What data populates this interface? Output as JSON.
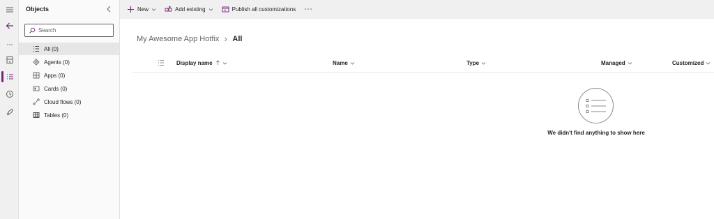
{
  "panel": {
    "title": "Objects",
    "search_placeholder": "Search",
    "items": [
      {
        "label": "All (0)",
        "icon": "list-icon",
        "selected": true
      },
      {
        "label": "Agents (0)",
        "icon": "agent-icon"
      },
      {
        "label": "Apps (0)",
        "icon": "apps-icon"
      },
      {
        "label": "Cards (0)",
        "icon": "card-icon"
      },
      {
        "label": "Cloud flows (0)",
        "icon": "flow-icon"
      },
      {
        "label": "Tables (0)",
        "icon": "table-icon"
      }
    ]
  },
  "toolbar": {
    "new_label": "New",
    "add_existing_label": "Add existing",
    "publish_label": "Publish all customizations"
  },
  "breadcrumb": {
    "parent": "My Awesome App Hotfix",
    "current": "All"
  },
  "columns": {
    "display_name": "Display name",
    "name": "Name",
    "type": "Type",
    "managed": "Managed",
    "customized": "Customized"
  },
  "empty_state": {
    "message": "We didn't find anything to show here"
  },
  "colors": {
    "accent": "#742774",
    "rail_bg": "#f0f0f0",
    "panel_bg": "#fafafa"
  }
}
